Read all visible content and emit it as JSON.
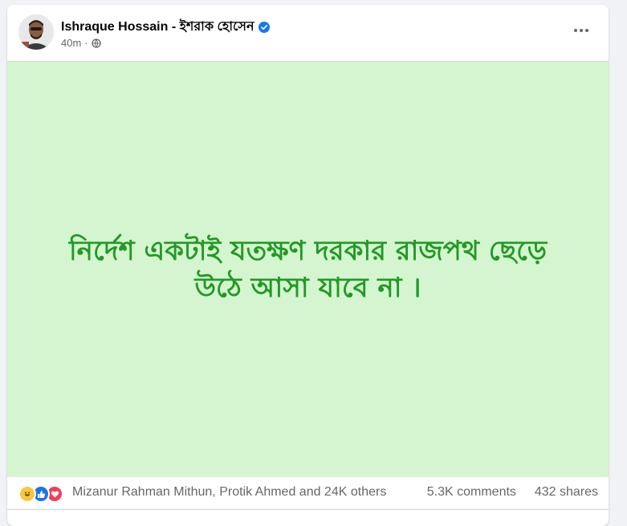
{
  "post": {
    "author": "Ishraque Hossain - ইশরাক হোসেন",
    "time": "40m",
    "separator": "·",
    "text": "নির্দেশ একটাই যতক্ষণ দরকার রাজপথ ছেড়ে উঠে আসা যাবে না ।",
    "background_color": "#d5f5d0",
    "text_color": "#219a24"
  },
  "footer": {
    "reactions": [
      "haha",
      "like",
      "love"
    ],
    "reactors": "Mizanur Rahman Mithun, Protik Ahmed and 24K others",
    "comments": "5.3K comments",
    "shares": "432 shares"
  },
  "icons": {
    "verified": "verified-badge-icon",
    "audience": "globe-icon",
    "more": "more-options-icon"
  }
}
